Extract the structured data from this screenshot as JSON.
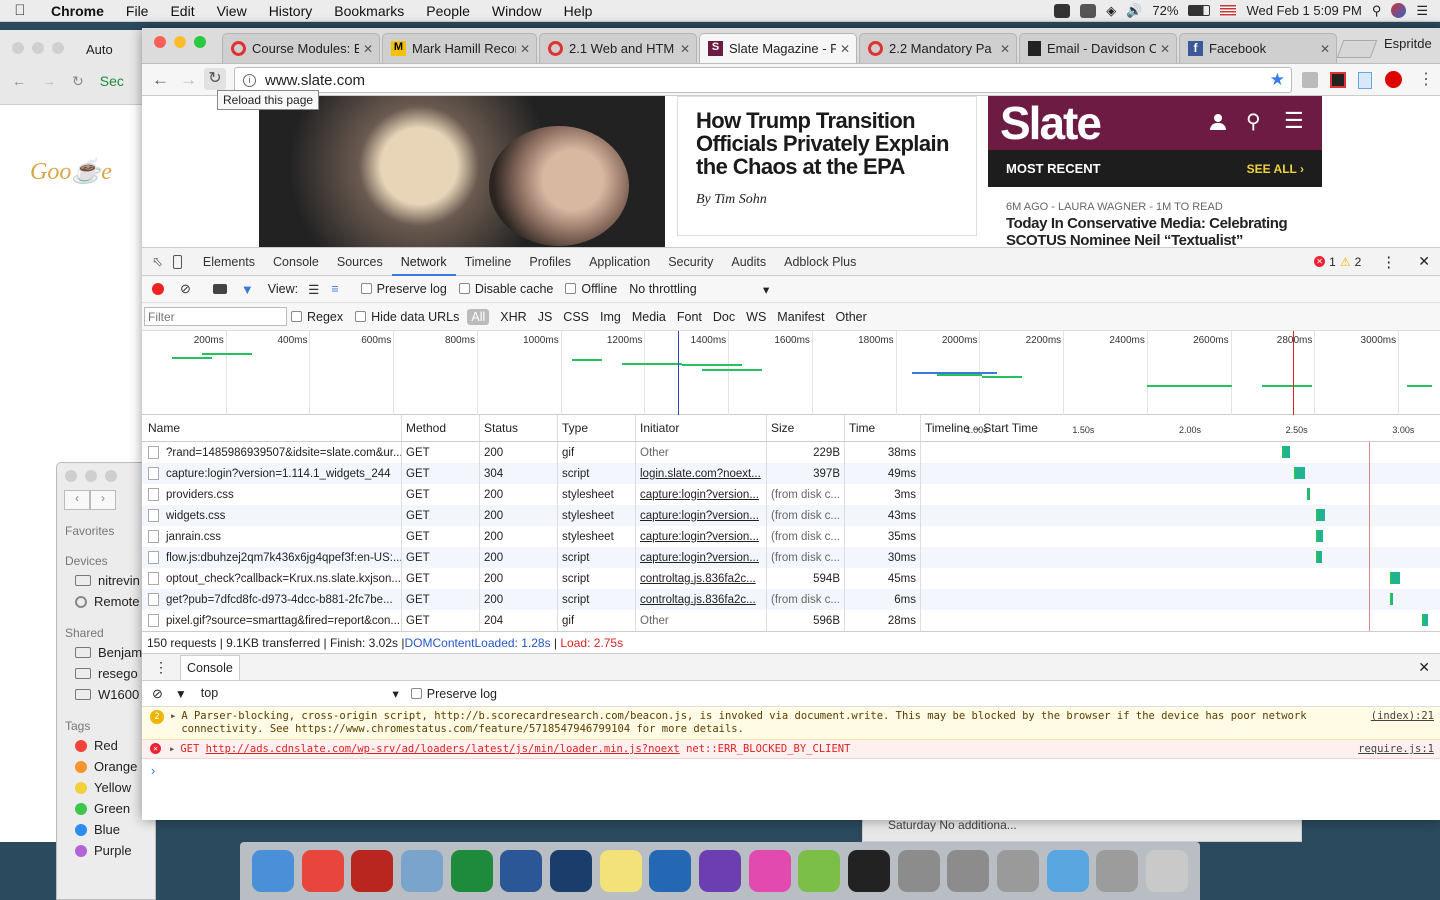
{
  "menubar": {
    "app": "Chrome",
    "items": [
      "File",
      "Edit",
      "View",
      "History",
      "Bookmarks",
      "People",
      "Window",
      "Help"
    ],
    "battery": "72%",
    "datetime": "Wed Feb 1  5:09 PM"
  },
  "bg_window": {
    "tab": "Auto",
    "lock_text": "Sec"
  },
  "finder": {
    "favorites_label": "Favorites",
    "devices_label": "Devices",
    "devices": [
      "nitrevin",
      "Remote"
    ],
    "shared_label": "Shared",
    "shared": [
      "Benjam",
      "resego",
      "W1600"
    ],
    "tags_label": "Tags",
    "tags": [
      {
        "label": "Red",
        "color": "#f3443b"
      },
      {
        "label": "Orange",
        "color": "#f5952d"
      },
      {
        "label": "Yellow",
        "color": "#f4d03a"
      },
      {
        "label": "Green",
        "color": "#3ec64b"
      },
      {
        "label": "Blue",
        "color": "#2d8cf0"
      },
      {
        "label": "Purple",
        "color": "#b463d9"
      }
    ]
  },
  "chrome": {
    "profile": "Espritde",
    "tabs": [
      {
        "title": "Course Modules: E",
        "active": false
      },
      {
        "title": "Mark Hamill Recor",
        "active": false
      },
      {
        "title": "2.1 Web and HTM",
        "active": false
      },
      {
        "title": "Slate Magazine - P",
        "active": true
      },
      {
        "title": "2.2 Mandatory Pa",
        "active": false
      },
      {
        "title": "Email - Davidson C",
        "active": false
      },
      {
        "title": "Facebook",
        "active": false
      }
    ],
    "url": "www.slate.com",
    "tooltip": "Reload this page"
  },
  "page": {
    "headline": "How Trump Transition Officials Privately Explain the Chaos at the EPA",
    "byline": "By Tim Sohn",
    "logo": "Slate",
    "most_recent": "MOST RECENT",
    "see_all": "SEE ALL",
    "meta": "6M AGO - LAURA WAGNER - 1M TO READ",
    "story": "Today In Conservative Media: Celebrating SCOTUS Nominee Neil “Textualist” Gorsuch"
  },
  "devtools": {
    "tabs": [
      "Elements",
      "Console",
      "Sources",
      "Network",
      "Timeline",
      "Profiles",
      "Application",
      "Security",
      "Audits",
      "Adblock Plus"
    ],
    "active_tab": "Network",
    "errors": "1",
    "warnings": "2",
    "netbar": {
      "view": "View:",
      "preserve": "Preserve log",
      "disable_cache": "Disable cache",
      "offline": "Offline",
      "throttle": "No throttling"
    },
    "filter": {
      "placeholder": "Filter",
      "regex": "Regex",
      "hide_data": "Hide data URLs",
      "types": [
        "All",
        "XHR",
        "JS",
        "CSS",
        "Img",
        "Media",
        "Font",
        "Doc",
        "WS",
        "Manifest",
        "Other"
      ]
    },
    "overview_ticks": [
      "200ms",
      "400ms",
      "600ms",
      "800ms",
      "1000ms",
      "1200ms",
      "1400ms",
      "1600ms",
      "1800ms",
      "2000ms",
      "2200ms",
      "2400ms",
      "2600ms",
      "2800ms",
      "3000ms"
    ],
    "columns": [
      "Name",
      "Method",
      "Status",
      "Type",
      "Initiator",
      "Size",
      "Time",
      "Timeline – Start Time"
    ],
    "timeline_ticks": [
      "1.00s",
      "1.50s",
      "2.00s",
      "2.50s",
      "3.00s"
    ],
    "rows": [
      {
        "name": "?rand=1485986939507&idsite=slate.com&ur...",
        "method": "GET",
        "status": "200",
        "type": "gif",
        "initiator": "Other",
        "init_link": false,
        "size": "229B",
        "time": "38ms",
        "start": 2.34
      },
      {
        "name": "capture:login?version=1.114.1_widgets_244",
        "method": "GET",
        "status": "304",
        "type": "script",
        "initiator": "login.slate.com?noext...",
        "init_link": true,
        "size": "397B",
        "time": "49ms",
        "start": 2.4
      },
      {
        "name": "providers.css",
        "method": "GET",
        "status": "200",
        "type": "stylesheet",
        "initiator": "capture:login?version...",
        "init_link": true,
        "size": "(from disk c...",
        "time": "3ms",
        "start": 2.46
      },
      {
        "name": "widgets.css",
        "method": "GET",
        "status": "200",
        "type": "stylesheet",
        "initiator": "capture:login?version...",
        "init_link": true,
        "size": "(from disk c...",
        "time": "43ms",
        "start": 2.5
      },
      {
        "name": "janrain.css",
        "method": "GET",
        "status": "200",
        "type": "stylesheet",
        "initiator": "capture:login?version...",
        "init_link": true,
        "size": "(from disk c...",
        "time": "35ms",
        "start": 2.5
      },
      {
        "name": "flow.js:dbuhzej2qm7k436x6jg4qpef3f:en-US:...",
        "method": "GET",
        "status": "200",
        "type": "script",
        "initiator": "capture:login?version...",
        "init_link": true,
        "size": "(from disk c...",
        "time": "30ms",
        "start": 2.5
      },
      {
        "name": "optout_check?callback=Krux.ns.slate.kxjson...",
        "method": "GET",
        "status": "200",
        "type": "script",
        "initiator": "controltag.js.836fa2c...",
        "init_link": true,
        "size": "594B",
        "time": "45ms",
        "start": 2.85
      },
      {
        "name": "get?pub=7dfcd8fc-d973-4dcc-b881-2fc7be...",
        "method": "GET",
        "status": "200",
        "type": "script",
        "initiator": "controltag.js.836fa2c...",
        "init_link": true,
        "size": "(from disk c...",
        "time": "6ms",
        "start": 2.85
      },
      {
        "name": "pixel.gif?source=smarttag&fired=report&con...",
        "method": "GET",
        "status": "204",
        "type": "gif",
        "initiator": "Other",
        "init_link": false,
        "size": "596B",
        "time": "28ms",
        "start": 3.0
      }
    ],
    "summary": {
      "requests": "150 requests | 9.1KB transferred | Finish: 3.02s | ",
      "dcl": "DOMContentLoaded: 1.28s",
      "sep": " | ",
      "load": "Load: 2.75s"
    },
    "drawer": {
      "tab": "Console",
      "context": "top",
      "preserve": "Preserve log",
      "warn_count": "2",
      "warning": "A Parser-blocking, cross-origin script, http://b.scorecardresearch.com/beacon.js, is invoked via document.write. This may be blocked by the browser if the device has poor network connectivity. See https://www.chromestatus.com/feature/5718547946799104 for more details.",
      "warning_src": "(index):21",
      "error_prefix": "GET ",
      "error_url": "http://ads.cdnslate.com/wp-srv/ad/loaders/latest/js/min/loader.min.js?noext",
      "error_suffix": " net::ERR_BLOCKED_BY_CLIENT",
      "error_src": "require.js:1",
      "prompt": "›"
    }
  },
  "bg_calendar": {
    "text": "Saturday  No additiona..."
  },
  "dock": [
    {
      "name": "finder-icon",
      "color": "#4a90d9"
    },
    {
      "name": "chrome-icon",
      "color": "#e8453c"
    },
    {
      "name": "filezilla-icon",
      "color": "#b8261f"
    },
    {
      "name": "preview-icon",
      "color": "#7aa4cc"
    },
    {
      "name": "excel-icon",
      "color": "#1e8b3c"
    },
    {
      "name": "word-icon",
      "color": "#2b5797"
    },
    {
      "name": "kindle-icon",
      "color": "#1a3d6b"
    },
    {
      "name": "notes-icon",
      "color": "#f3e27a"
    },
    {
      "name": "rstudio-icon",
      "color": "#2468b4"
    },
    {
      "name": "siri-icon",
      "color": "#6c3fb0"
    },
    {
      "name": "itunes-icon",
      "color": "#e24ab0"
    },
    {
      "name": "maps-icon",
      "color": "#7bbf49"
    },
    {
      "name": "terminal-icon",
      "color": "#222222"
    },
    {
      "name": "question-icon",
      "color": "#8c8c8c"
    },
    {
      "name": "question-icon",
      "color": "#8c8c8c"
    },
    {
      "name": "documents-icon",
      "color": "#9a9a9a"
    },
    {
      "name": "applications-folder-icon",
      "color": "#5aa6e0"
    },
    {
      "name": "downloads-icon",
      "color": "#9c9c9c"
    },
    {
      "name": "trash-icon",
      "color": "#c9c9c9"
    }
  ]
}
